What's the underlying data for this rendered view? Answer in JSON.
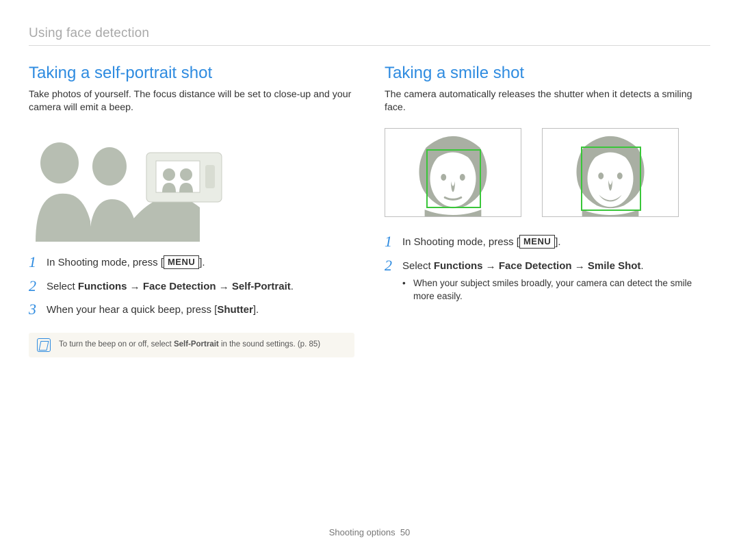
{
  "breadcrumb": "Using face detection",
  "left": {
    "title": "Taking a self-portrait shot",
    "intro": "Take photos of yourself. The focus distance will be set to close-up and your camera will emit a beep.",
    "step1_prefix": "In Shooting mode, press [",
    "step1_menu": "MENU",
    "step1_suffix": "].",
    "step2_prefix": "Select ",
    "step2_bold": "Functions → Face Detection → Self-Portrait",
    "step2_suffix": ".",
    "step3_prefix": "When your hear a quick beep, press [",
    "step3_bold": "Shutter",
    "step3_suffix": "].",
    "note_prefix": "To turn the beep on or off, select ",
    "note_bold": "Self-Portrait",
    "note_suffix": " in the sound settings. (p. 85)",
    "num1": "1",
    "num2": "2",
    "num3": "3"
  },
  "right": {
    "title": "Taking a smile shot",
    "intro": "The camera automatically releases the shutter when it detects a smiling face.",
    "step1_prefix": "In Shooting mode, press [",
    "step1_menu": "MENU",
    "step1_suffix": "].",
    "step2_prefix": "Select ",
    "step2_bold": "Functions → Face Detection → Smile Shot",
    "step2_suffix": ".",
    "bullet1": "When your subject smiles broadly, your camera can detect the smile more easily.",
    "num1": "1",
    "num2": "2"
  },
  "footer_label": "Shooting options",
  "footer_page": "50"
}
